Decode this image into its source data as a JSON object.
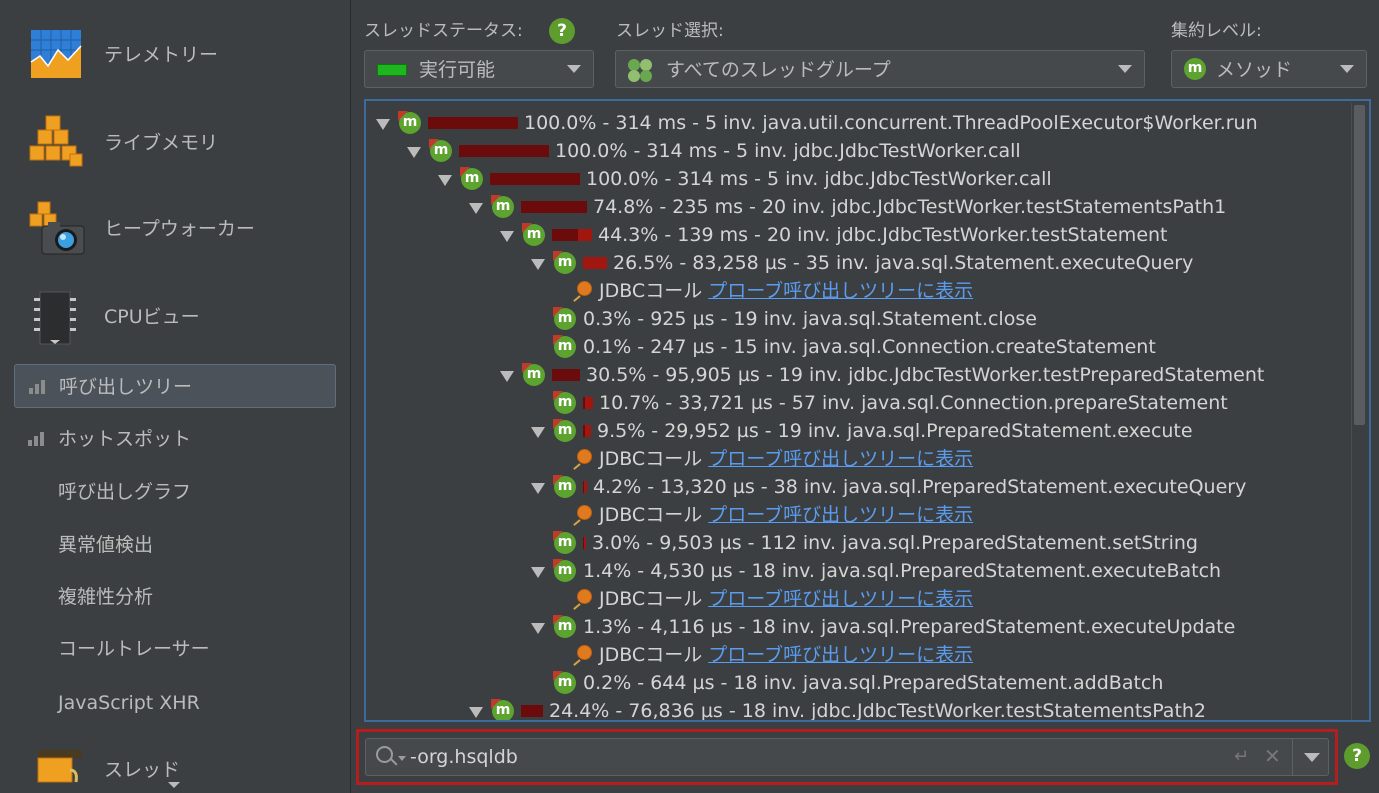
{
  "sidebar": {
    "big_items": [
      {
        "label": "テレメトリー",
        "icon": "telemetry-icon"
      },
      {
        "label": "ライブメモリ",
        "icon": "live-memory-icon"
      },
      {
        "label": "ヒープウォーカー",
        "icon": "heap-walker-icon"
      },
      {
        "label": "CPUビュー",
        "icon": "cpu-icon"
      }
    ],
    "cpu_items": [
      {
        "label": "呼び出しツリー",
        "selected": true
      },
      {
        "label": "ホットスポット"
      },
      {
        "label": "呼び出しグラフ"
      },
      {
        "label": "異常値検出"
      },
      {
        "label": "複雑性分析"
      },
      {
        "label": "コールトレーサー"
      },
      {
        "label": "JavaScript XHR"
      }
    ],
    "threads_item": {
      "label": "スレッド",
      "icon": "threads-icon"
    }
  },
  "controls": {
    "thread_status_label": "スレッドステータス:",
    "thread_status_value": "実行可能",
    "thread_select_label": "スレッド選択:",
    "thread_select_value": "すべてのスレッドグループ",
    "aggregation_label": "集約レベル:",
    "aggregation_value": "メソッド",
    "help_glyph": "?",
    "status_color": "#1fb51f"
  },
  "tree": {
    "rows": [
      {
        "text": "100.0% - 314 ms - 5 inv. java.util.concurrent.ThreadPoolExecutor$Worker.run"
      },
      {
        "text": "100.0% - 314 ms - 5 inv. jdbc.JdbcTestWorker.call"
      },
      {
        "text": "100.0% - 314 ms - 5 inv. jdbc.JdbcTestWorker.call"
      },
      {
        "text": "74.8% - 235 ms - 20 inv. jdbc.JdbcTestWorker.testStatementsPath1"
      },
      {
        "text": "44.3% - 139 ms - 20 inv. jdbc.JdbcTestWorker.testStatement"
      },
      {
        "text": "26.5% - 83,258 µs - 35 inv. java.sql.Statement.executeQuery"
      },
      {
        "probe_label": "JDBCコール",
        "probe_link": "プローブ呼び出しツリーに表示"
      },
      {
        "text": "0.3% - 925 µs - 19 inv. java.sql.Statement.close"
      },
      {
        "text": "0.1% - 247 µs - 15 inv. java.sql.Connection.createStatement"
      },
      {
        "text": "30.5% - 95,905 µs - 19 inv. jdbc.JdbcTestWorker.testPreparedStatement"
      },
      {
        "text": "10.7% - 33,721 µs - 57 inv. java.sql.Connection.prepareStatement"
      },
      {
        "text": "9.5% - 29,952 µs - 19 inv. java.sql.PreparedStatement.execute"
      },
      {
        "probe_label": "JDBCコール",
        "probe_link": "プローブ呼び出しツリーに表示"
      },
      {
        "text": "4.2% - 13,320 µs - 38 inv. java.sql.PreparedStatement.executeQuery"
      },
      {
        "probe_label": "JDBCコール",
        "probe_link": "プローブ呼び出しツリーに表示"
      },
      {
        "text": "3.0% - 9,503 µs - 112 inv. java.sql.PreparedStatement.setString"
      },
      {
        "text": "1.4% - 4,530 µs - 18 inv. java.sql.PreparedStatement.executeBatch"
      },
      {
        "probe_label": "JDBCコール",
        "probe_link": "プローブ呼び出しツリーに表示"
      },
      {
        "text": "1.3% - 4,116 µs - 18 inv. java.sql.PreparedStatement.executeUpdate"
      },
      {
        "probe_label": "JDBCコール",
        "probe_link": "プローブ呼び出しツリーに表示"
      },
      {
        "text": "0.2% - 644 µs - 18 inv. java.sql.PreparedStatement.addBatch"
      },
      {
        "text": "24.4% - 76,836 µs - 18 inv. jdbc.JdbcTestWorker.testStatementsPath2"
      }
    ],
    "method_glyph": "m"
  },
  "filter": {
    "value": "-org.hsqldb",
    "enter_glyph": "↵",
    "clear_glyph": "✕"
  }
}
